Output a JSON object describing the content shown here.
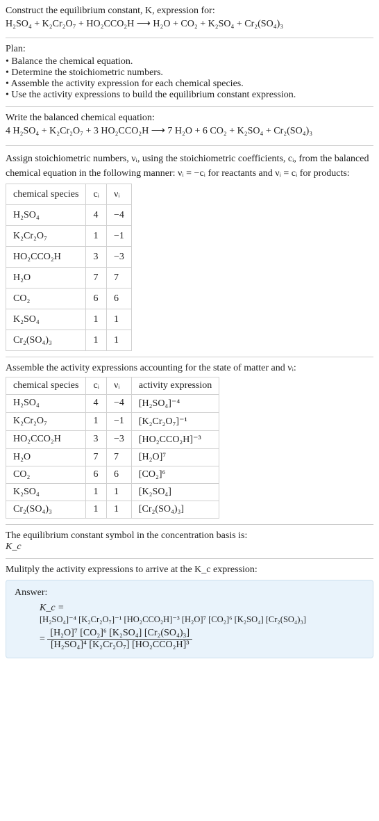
{
  "title_line1": "Construct the equilibrium constant, K, expression for:",
  "title_eqn": "H₂SO₄ + K₂Cr₂O₇ + HO₂CCO₂H  ⟶  H₂O + CO₂ + K₂SO₄ + Cr₂(SO₄)₃",
  "plan_heading": "Plan:",
  "plan_items": [
    "Balance the chemical equation.",
    "Determine the stoichiometric numbers.",
    "Assemble the activity expression for each chemical species.",
    "Use the activity expressions to build the equilibrium constant expression."
  ],
  "balanced_heading": "Write the balanced chemical equation:",
  "balanced_eqn": "4 H₂SO₄ + K₂Cr₂O₇ + 3 HO₂CCO₂H  ⟶  7 H₂O + 6 CO₂ + K₂SO₄ + Cr₂(SO₄)₃",
  "assign_text_a": "Assign stoichiometric numbers, νᵢ, using the stoichiometric coefficients, cᵢ, from the balanced chemical equation in the following manner: νᵢ = −cᵢ for reactants and νᵢ = cᵢ for products:",
  "table1": {
    "headers": [
      "chemical species",
      "cᵢ",
      "νᵢ"
    ],
    "rows": [
      [
        "H₂SO₄",
        "4",
        "−4"
      ],
      [
        "K₂Cr₂O₇",
        "1",
        "−1"
      ],
      [
        "HO₂CCO₂H",
        "3",
        "−3"
      ],
      [
        "H₂O",
        "7",
        "7"
      ],
      [
        "CO₂",
        "6",
        "6"
      ],
      [
        "K₂SO₄",
        "1",
        "1"
      ],
      [
        "Cr₂(SO₄)₃",
        "1",
        "1"
      ]
    ]
  },
  "assemble_text": "Assemble the activity expressions accounting for the state of matter and νᵢ:",
  "table2": {
    "headers": [
      "chemical species",
      "cᵢ",
      "νᵢ",
      "activity expression"
    ],
    "rows": [
      [
        "H₂SO₄",
        "4",
        "−4",
        "[H₂SO₄]⁻⁴"
      ],
      [
        "K₂Cr₂O₇",
        "1",
        "−1",
        "[K₂Cr₂O₇]⁻¹"
      ],
      [
        "HO₂CCO₂H",
        "3",
        "−3",
        "[HO₂CCO₂H]⁻³"
      ],
      [
        "H₂O",
        "7",
        "7",
        "[H₂O]⁷"
      ],
      [
        "CO₂",
        "6",
        "6",
        "[CO₂]⁶"
      ],
      [
        "K₂SO₄",
        "1",
        "1",
        "[K₂SO₄]"
      ],
      [
        "Cr₂(SO₄)₃",
        "1",
        "1",
        "[Cr₂(SO₄)₃]"
      ]
    ]
  },
  "kc_line1": "The equilibrium constant symbol in the concentration basis is:",
  "kc_symbol": "K_c",
  "multiply_text": "Mulitply the activity expressions to arrive at the K_c expression:",
  "answer_label": "Answer:",
  "answer_kc_eq": "K_c =",
  "answer_line1": "[H₂SO₄]⁻⁴ [K₂Cr₂O₇]⁻¹ [HO₂CCO₂H]⁻³ [H₂O]⁷ [CO₂]⁶ [K₂SO₄] [Cr₂(SO₄)₃]",
  "answer_frac_num": "[H₂O]⁷ [CO₂]⁶ [K₂SO₄] [Cr₂(SO₄)₃]",
  "answer_frac_den": "[H₂SO₄]⁴ [K₂Cr₂O₇] [HO₂CCO₂H]³",
  "answer_eq_sign": "="
}
